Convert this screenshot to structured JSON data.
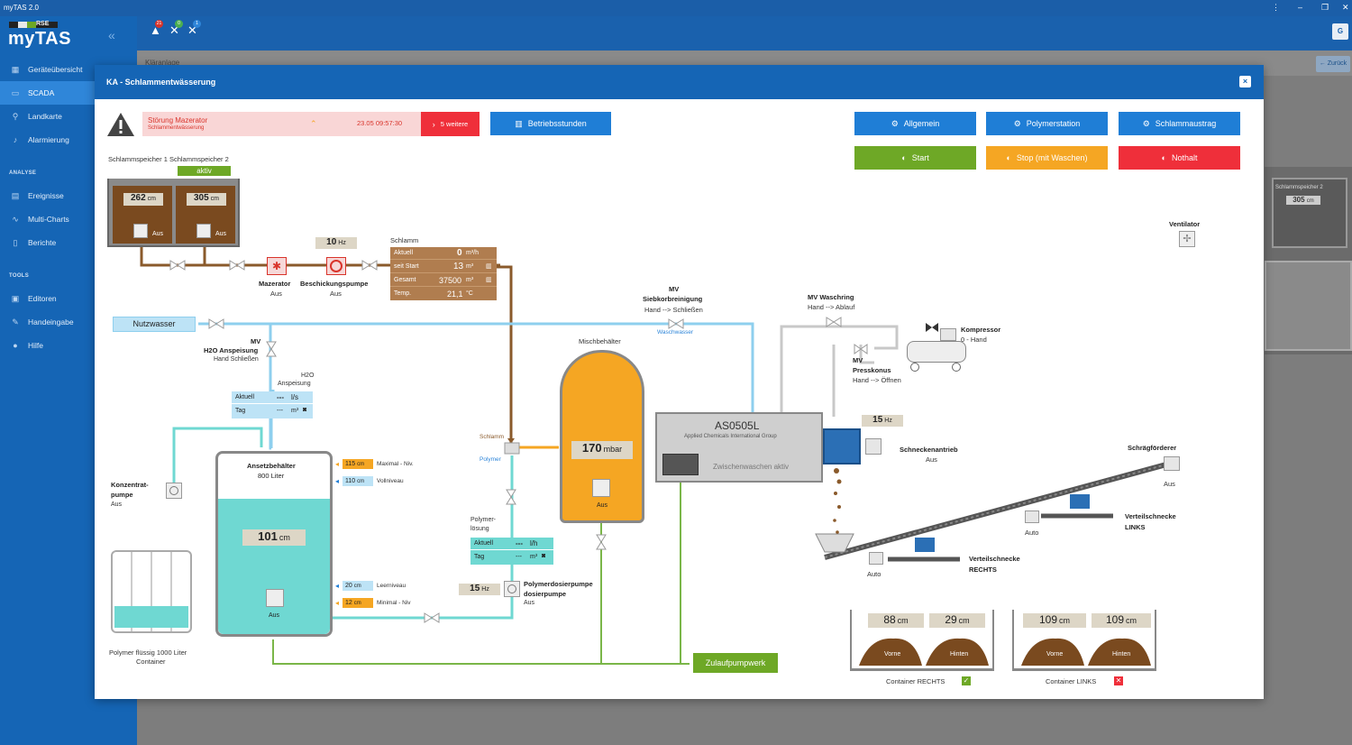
{
  "app": {
    "title": "myTAS 2.0",
    "logo": "myTAS",
    "logo_brand": "RSE"
  },
  "sidebar": {
    "items": [
      {
        "label": "Geräteübersicht",
        "icon": "dashboard-icon"
      },
      {
        "label": "SCADA",
        "icon": "monitor-icon"
      },
      {
        "label": "Landkarte",
        "icon": "map-pin-icon"
      },
      {
        "label": "Alarmierung",
        "icon": "bell-icon"
      }
    ],
    "section_analyse": "ANALYSE",
    "analyse_items": [
      {
        "label": "Ereignisse",
        "icon": "list-icon"
      },
      {
        "label": "Multi-Charts",
        "icon": "chart-icon"
      },
      {
        "label": "Berichte",
        "icon": "report-icon"
      }
    ],
    "section_tools": "TOOLS",
    "tools_items": [
      {
        "label": "Editoren",
        "icon": "editor-icon"
      },
      {
        "label": "Handeingabe",
        "icon": "pencil-icon"
      },
      {
        "label": "Hilfe",
        "icon": "info-icon"
      }
    ]
  },
  "topbar": {
    "alerts": [
      {
        "count": "21",
        "color": "#d9342b"
      },
      {
        "count": "0",
        "color": "#4caf50"
      },
      {
        "count": "1",
        "color": "#2f86d9"
      }
    ],
    "user_initial": "G"
  },
  "background": {
    "breadcrumb": "Kläranlage",
    "back_label": "Zurück",
    "mini_label": "Schlammspeicher 2",
    "mini_value": "305",
    "mini_unit": "cm"
  },
  "modal": {
    "title": "KA - Schlammentwässerung",
    "close": "×",
    "alarm": {
      "title": "Störung Mazerator",
      "subtitle": "Schlammentwässerung",
      "time": "23.05 09:57:30",
      "more": "5 weitere"
    },
    "btn_betriebsstunden": "Betriebsstunden",
    "btn_allgemein": "Allgemein",
    "btn_polymerstation": "Polymerstation",
    "btn_schlammaustrag": "Schlammaustrag",
    "btn_start": "Start",
    "btn_stop": "Stop (mit Waschen)",
    "btn_nothalt": "Nothalt",
    "colors": {
      "blue_btn": "#1f7ed6",
      "green_btn": "#6ea826",
      "orange_btn": "#f5a623",
      "red_btn": "#ef2f3a",
      "sludge": "#8a5a2b",
      "water": "#8ecfee",
      "polymer": "#6fd8d2",
      "green_pipe": "#7ab648"
    }
  },
  "process": {
    "speicher_labels": "Schlammspeicher 1 Schlammspeicher 2",
    "aktiv": "aktiv",
    "speicher1": {
      "value": "262",
      "unit": "cm",
      "state": "Aus"
    },
    "speicher2": {
      "value": "305",
      "unit": "cm",
      "state": "Aus"
    },
    "freq_beschickung": {
      "value": "10",
      "unit": "Hz"
    },
    "mazerator": {
      "label": "Mazerator",
      "state": "Aus"
    },
    "beschickungspumpe": {
      "label": "Beschickungspumpe",
      "state": "Aus"
    },
    "schlamm": {
      "title": "Schlamm",
      "rows": [
        {
          "label": "Aktuell",
          "value": "0",
          "unit": "m³/h"
        },
        {
          "label": "seit Start",
          "value": "13",
          "unit": "m³"
        },
        {
          "label": "Gesamt",
          "value": "37500",
          "unit": "m³"
        },
        {
          "label": "Temp.",
          "value": "21,1",
          "unit": "°C"
        }
      ]
    },
    "nutzwasser": "Nutzwasser",
    "mv_h2o": {
      "l1": "MV",
      "l2": "H2O Anspeisung",
      "l3": "Hand Schließen"
    },
    "h2o_anspeisung": {
      "title1": "H2O",
      "title2": "Anspeisung",
      "rows": [
        {
          "label": "Aktuell",
          "value": "---",
          "unit": "l/s"
        },
        {
          "label": "Tag",
          "value": "---",
          "unit": "m³"
        }
      ]
    },
    "mv_sieb": {
      "l1": "MV",
      "l2": "Siebkorbreinigung",
      "l3": "Hand --> Schließen"
    },
    "waschwasser": "Waschwasser",
    "mv_waschring": {
      "l1": "MV Waschring",
      "l2": "Hand --> Ablauf"
    },
    "kompressor": {
      "label": "Kompressor",
      "state": "0 - Hand"
    },
    "mv_presskonus": {
      "l1": "MV",
      "l2": "Presskonus",
      "l3": "Hand --> Öffnen"
    },
    "ventilator": "Ventilator",
    "mischbehaelter": {
      "label": "Mischbehälter",
      "value": "170",
      "unit": "mbar",
      "state": "Aus"
    },
    "schlamm_tag": "Schlamm",
    "polymer_tag": "Polymer",
    "ansetz": {
      "title1": "Ansetzbehälter",
      "title2": "800 Liter",
      "value": "101",
      "unit": "cm",
      "state": "Aus",
      "levels": [
        {
          "value": "115",
          "unit": "cm",
          "label": "Maximal - Niv."
        },
        {
          "value": "110",
          "unit": "cm",
          "label": "Vollniveau"
        },
        {
          "value": "20",
          "unit": "cm",
          "label": "Leerniveau"
        },
        {
          "value": "12",
          "unit": "cm",
          "label": "Minimal - Niv"
        }
      ]
    },
    "konzentrat": {
      "l1": "Konzentrat-",
      "l2": "pumpe",
      "state": "Aus"
    },
    "polymer_container": {
      "l1": "Polymer flüssig 1000 Liter",
      "l2": "Container"
    },
    "polymerloesung": {
      "title1": "Polymer-",
      "title2": "lösung",
      "rows": [
        {
          "label": "Aktuell",
          "value": "---",
          "unit": "l/h"
        },
        {
          "label": "Tag",
          "value": "---",
          "unit": "m³"
        }
      ]
    },
    "freq_polymer": {
      "value": "15",
      "unit": "Hz"
    },
    "polymerdosierpumpe": {
      "l1": "Polymerdosierpumpe",
      "l2": "dosierpumpe",
      "state": "Aus"
    },
    "press": {
      "model": "AS0505L",
      "company": "Applied Chemicals International Group",
      "status": "Zwischenwaschen aktiv"
    },
    "freq_schnecke": {
      "value": "15",
      "unit": "Hz"
    },
    "schneckenantrieb": {
      "label": "Schneckenantrieb",
      "state": "Aus"
    },
    "schraegfoerderer": {
      "label": "Schrägförderer",
      "state": "Aus"
    },
    "verteil_links": {
      "l1": "Verteilschnecke",
      "l2": "LINKS",
      "state": "Auto"
    },
    "verteil_rechts": {
      "l1": "Verteilschnecke",
      "l2": "RECHTS",
      "state": "Auto"
    },
    "zulauf": "Zulaufpumpwerk",
    "container_rechts": {
      "label": "Container RECHTS",
      "vorne": "88",
      "hinten": "29",
      "unit": "cm",
      "vorne_label": "Vorne",
      "hinten_label": "Hinten"
    },
    "container_links": {
      "label": "Container LINKS",
      "vorne": "109",
      "hinten": "109",
      "unit": "cm",
      "vorne_label": "Vorne",
      "hinten_label": "Hinten"
    }
  }
}
